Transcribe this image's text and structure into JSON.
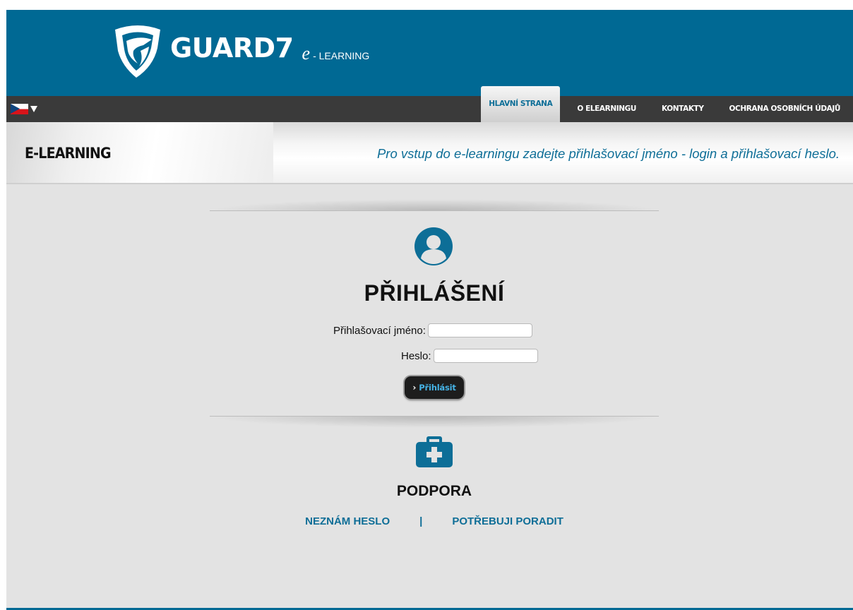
{
  "header": {
    "brand": "GUARD7",
    "brand_e": "e",
    "brand_sub": "- LEARNING",
    "logo_icon": "shield-logo-icon"
  },
  "language": {
    "current": "cs",
    "flag_icon": "czech-flag-icon"
  },
  "nav": {
    "items": [
      {
        "label": "HLAVNÍ STRANA",
        "active": true
      },
      {
        "label": "O ELEARNINGU",
        "active": false
      },
      {
        "label": "KONTAKTY",
        "active": false
      },
      {
        "label": "OCHRANA OSOBNÍCH ÚDAJŮ",
        "active": false
      }
    ]
  },
  "titlebar": {
    "title": "E-LEARNING",
    "tagline": "Pro vstup do e-learningu zadejte přihlašovací jméno - login a přihlašovací heslo."
  },
  "login": {
    "title": "PŘIHLÁŠENÍ",
    "username_label": "Přihlašovací jméno:",
    "username_value": "",
    "password_label": "Heslo:",
    "password_value": "",
    "submit_label": "Přihlásit",
    "icon": "user-icon"
  },
  "support": {
    "title": "PODPORA",
    "icon": "first-aid-kit-icon",
    "link_forgot": "NEZNÁM HESLO",
    "separator": "|",
    "link_help": "POTŘEBUJI PORADIT"
  },
  "colors": {
    "brand_blue": "#006994",
    "link_blue": "#0e6e97",
    "nav_dark": "#3a3a3a",
    "page_bg": "#e3e3e3",
    "button_text": "#45b3e6"
  }
}
